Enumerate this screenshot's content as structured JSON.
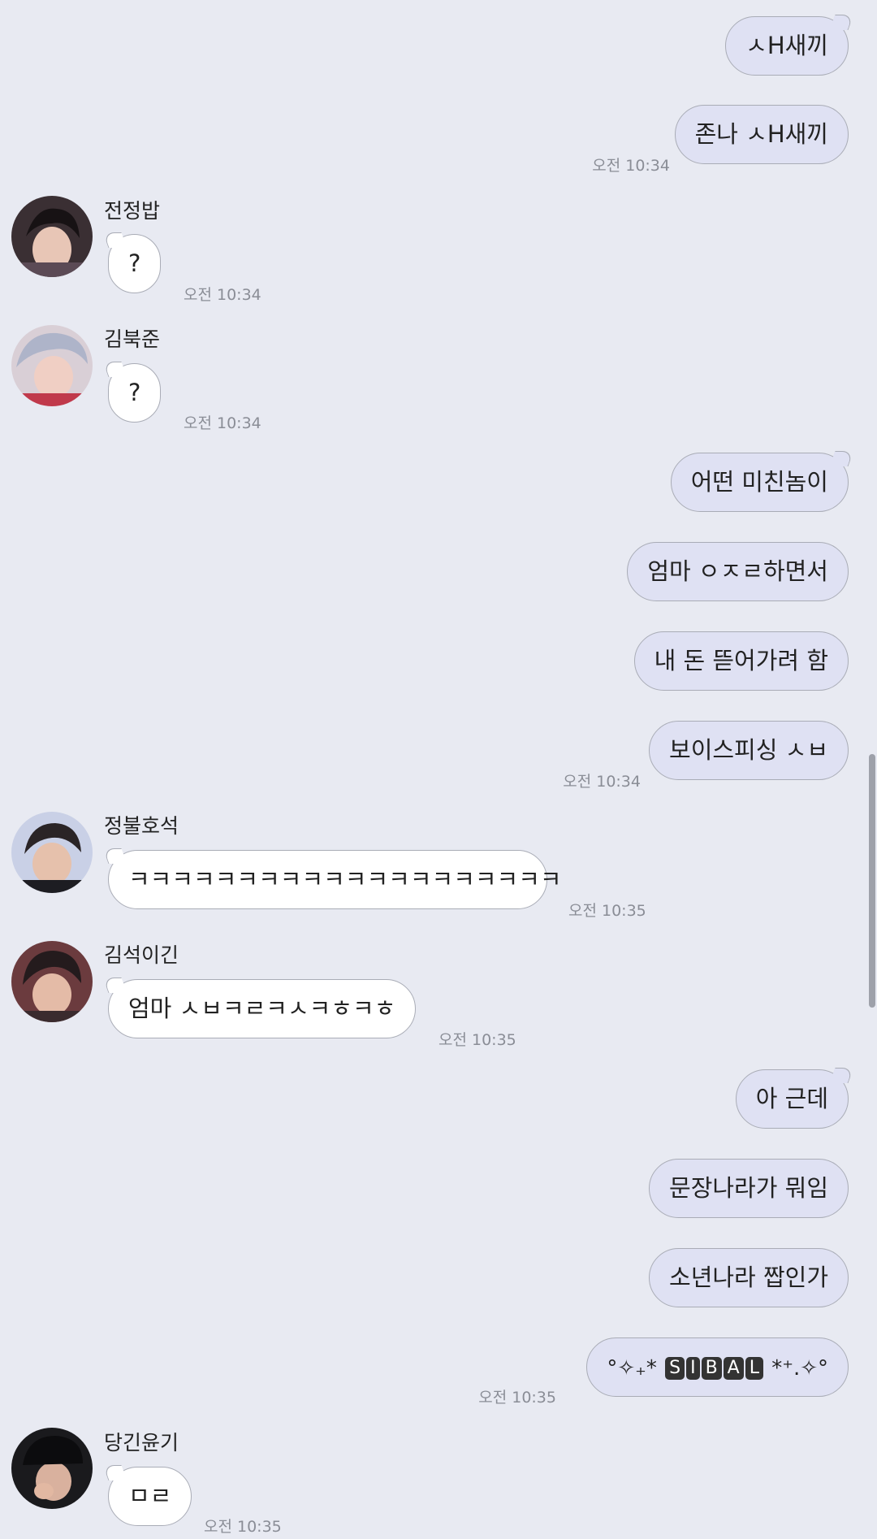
{
  "messages": [
    {
      "from": "me",
      "text": "ㅅH새끼"
    },
    {
      "from": "me",
      "text": "존나 ㅅH새끼",
      "time": "오전 10:34"
    },
    {
      "from": "other",
      "name": "전정밥",
      "text": "?",
      "time": "오전 10:34"
    },
    {
      "from": "other",
      "name": "김북준",
      "text": "?",
      "time": "오전 10:34"
    },
    {
      "from": "me",
      "text": "어떤 미친놈이"
    },
    {
      "from": "me",
      "text": "엄마 ㅇㅈㄹ하면서"
    },
    {
      "from": "me",
      "text": "내 돈 뜯어가려 함"
    },
    {
      "from": "me",
      "text": "보이스피싱 ㅅㅂ",
      "time": "오전 10:34"
    },
    {
      "from": "other",
      "name": "정불호석",
      "text": "ㅋㅋㅋㅋㅋㅋㅋㅋㅋㅋㅋㅋㅋㅋㅋㅋㅋㅋㅋㅋ",
      "time": "오전 10:35"
    },
    {
      "from": "other",
      "name": "김석이긴",
      "text": "엄마 ㅅㅂㅋㄹㅋㅅㅋㅎㅋㅎ",
      "time": "오전 10:35"
    },
    {
      "from": "me",
      "text": "아 근데"
    },
    {
      "from": "me",
      "text": "문장나라가 뭐임"
    },
    {
      "from": "me",
      "text": "소년나라 짭인가"
    },
    {
      "from": "me",
      "sibal": {
        "pre": "°✧₊*",
        "letters": [
          "S",
          "I",
          "B",
          "A",
          "L"
        ],
        "post": "*⁺.✧°"
      },
      "time": "오전 10:35"
    },
    {
      "from": "other",
      "name": "당긴윤기",
      "text": "ㅁㄹ",
      "time": "오전 10:35"
    }
  ],
  "colors": {
    "background": "#e8eaf2",
    "my_bubble": "#dfe1f3",
    "their_bubble": "#ffffff"
  },
  "icons": {
    "avatar_1": "profile-photo",
    "avatar_2": "profile-photo",
    "avatar_3": "profile-photo",
    "avatar_4": "profile-photo",
    "avatar_5": "profile-photo"
  }
}
